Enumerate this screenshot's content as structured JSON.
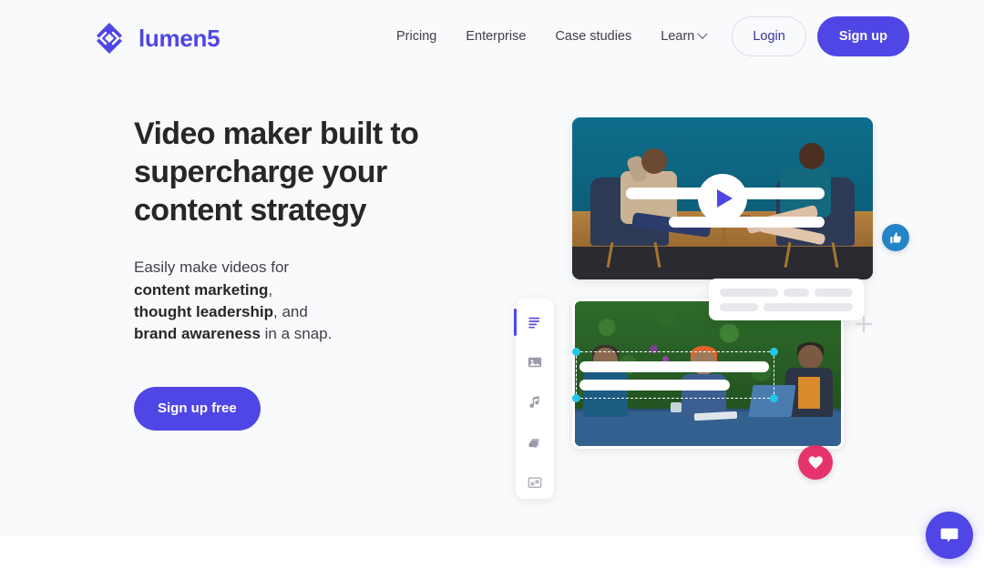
{
  "brand": {
    "name": "lumen5",
    "logo_icon": "lumen5-diamond-logo-icon",
    "accent_color": "#4f46e5"
  },
  "header": {
    "nav_links": [
      {
        "label": "Pricing",
        "has_dropdown": false
      },
      {
        "label": "Enterprise",
        "has_dropdown": false
      },
      {
        "label": "Case studies",
        "has_dropdown": false
      },
      {
        "label": "Learn",
        "has_dropdown": true,
        "dropdown_icon": "chevron-down-icon"
      }
    ],
    "login_label": "Login",
    "signup_label": "Sign up"
  },
  "hero": {
    "headline": "Video maker built to supercharge your content strategy",
    "subhead": {
      "lead": "Easily make videos for",
      "bold_1": "content marketing",
      "comma_1": ",",
      "bold_2": "thought leadership",
      "mid": ", and",
      "bold_3": "brand awareness",
      "tail": " in a snap."
    },
    "cta_label": "Sign up free"
  },
  "illustration": {
    "video_top": {
      "name": "interview-video-preview",
      "play_icon": "play-triangle-icon",
      "text_bar_count": 2
    },
    "video_bottom": {
      "name": "team-video-preview",
      "selection_handles": 4,
      "handle_color": "#21c6ea",
      "text_bar_count": 2
    },
    "floating_card": {
      "name": "text-placeholder-card",
      "placeholder_rows": 2,
      "placeholder_color": "#e7e7ec"
    },
    "move_cursor_icon": "move-crosshair-icon",
    "badges": [
      {
        "name": "like-badge",
        "icon": "thumbs-up-icon",
        "color": "#2484c6"
      },
      {
        "name": "heart-badge",
        "icon": "heart-icon",
        "color": "#e6336b"
      }
    ],
    "editor_rail": {
      "items": [
        {
          "label": "Text",
          "icon": "text-lines-icon",
          "active": true
        },
        {
          "label": "Media",
          "icon": "image-icon",
          "active": false
        },
        {
          "label": "Music",
          "icon": "music-note-icon",
          "active": false
        },
        {
          "label": "Stickers",
          "icon": "layers-icon",
          "active": false
        },
        {
          "label": "Layout",
          "icon": "expand-frame-icon",
          "active": false
        }
      ]
    }
  },
  "chat_widget": {
    "label": "Open chat",
    "icon": "chat-bubble-icon",
    "color": "#4f46e5"
  }
}
